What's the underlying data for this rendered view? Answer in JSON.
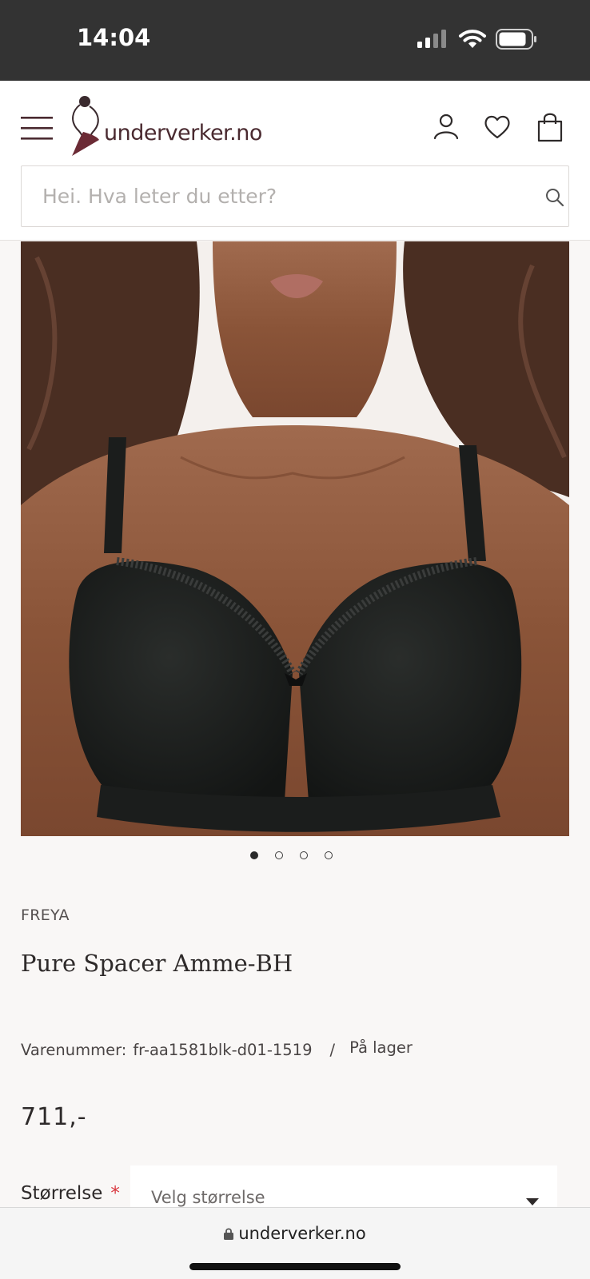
{
  "status_bar": {
    "time": "14:04"
  },
  "header": {
    "logo_text": "underverker.no",
    "search": {
      "placeholder": "Hei. Hva leter du etter?"
    }
  },
  "product": {
    "image_count": 4,
    "active_image": 1,
    "brand": "FREYA",
    "title": "Pure Spacer Amme-BH",
    "sku_label": "Varenummer:",
    "sku": "fr-aa1581blk-d01-1519",
    "separator": "/",
    "stock": "På lager",
    "price": "711,-",
    "size_label": "Størrelse",
    "required_mark": "*",
    "size_placeholder": "Velg størrelse"
  },
  "browser": {
    "url": "underverker.no"
  },
  "colors": {
    "status_bar": "#333333",
    "page_bg": "#f9f7f6",
    "logo": "#4a2a30",
    "required": "#d9363e",
    "bra": "#1b1d1c"
  }
}
